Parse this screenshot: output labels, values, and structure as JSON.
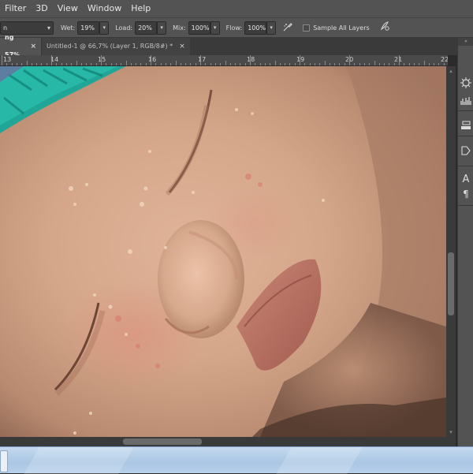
{
  "menu": {
    "items": [
      "Filter",
      "3D",
      "View",
      "Window",
      "Help"
    ]
  },
  "options": {
    "mode_value": "n",
    "wet_label": "Wet:",
    "wet_value": "19%",
    "load_label": "Load:",
    "load_value": "20%",
    "mix_label": "Mix:",
    "mix_value": "100%",
    "flow_label": "Flow:",
    "flow_value": "100%",
    "sample_all_layers_label": "Sample All Layers",
    "airbrush_icon": "airbrush-icon",
    "pen_icon": "pressure-pen-icon"
  },
  "tabs": [
    {
      "label": "ng 57%",
      "close": "×",
      "active": true
    },
    {
      "label": "Untitled-1 @ 66,7% (Layer 1, RGB/8#) *",
      "close": "×",
      "active": false
    }
  ],
  "ruler": {
    "labels": [
      "13",
      "14",
      "15",
      "16",
      "17",
      "18",
      "19",
      "20",
      "21",
      "22"
    ]
  },
  "right_panel": {
    "icons": [
      "color-wheel-icon",
      "histogram-icon",
      "adjustments-icon",
      "swatches-icon",
      "paths-icon",
      "character-icon",
      "paragraph-icon"
    ],
    "character_glyph": "A",
    "paragraph_glyph": "¶",
    "collapse_glyph": "«"
  },
  "colors": {
    "ui_dark": "#535353",
    "canvas_bg": "#3a3a3a",
    "skin": "#c79e82",
    "knit": "#1fa697",
    "taskbar": "#b8d1ea"
  }
}
